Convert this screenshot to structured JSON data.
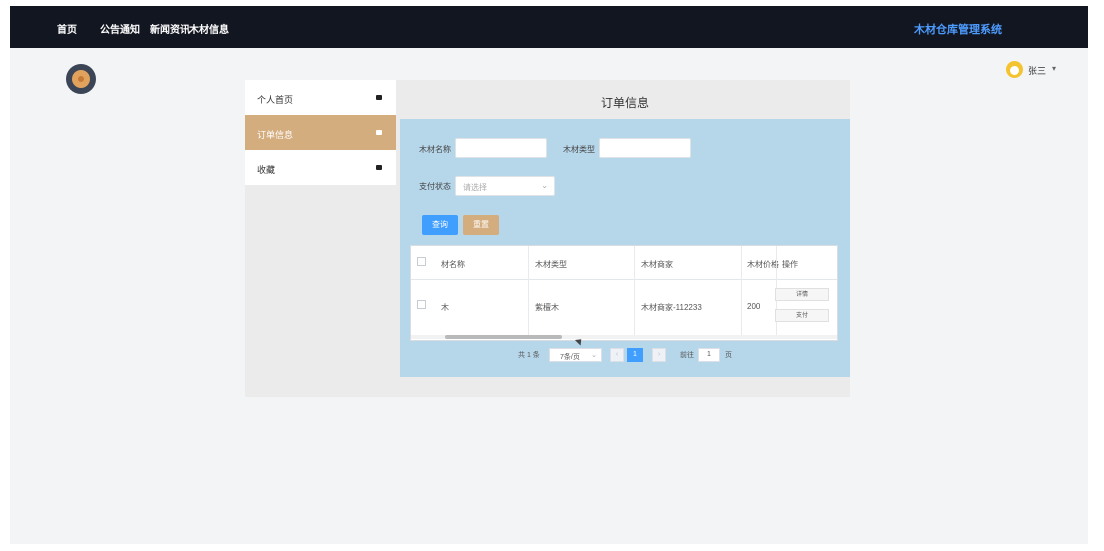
{
  "navbar": {
    "items": [
      "首页",
      "公告通知",
      "新闻资讯",
      "木材信息"
    ],
    "brand": "木材仓库管理系统",
    "user_name": "张三"
  },
  "sidebar": {
    "items": [
      {
        "label": "个人首页"
      },
      {
        "label": "订单信息"
      },
      {
        "label": "收藏"
      }
    ]
  },
  "content": {
    "title": "订单信息",
    "filters": {
      "name_label": "木材名称",
      "type_label": "木材类型",
      "status_label": "支付状态",
      "status_placeholder": "请选择"
    },
    "buttons": {
      "query": "查询",
      "reset": "重置"
    },
    "table": {
      "headers": [
        "材名称",
        "木材类型",
        "木材商家",
        "木材价格",
        "操作"
      ],
      "rows": [
        {
          "name": "木",
          "type": "紫檀木",
          "merchant": "木材商家-112233",
          "price": "200",
          "actions": [
            "详情",
            "支付"
          ]
        }
      ]
    },
    "pagination": {
      "total": "共 1 条",
      "page_size": "7条/页",
      "current": "1",
      "goto_label": "前往",
      "goto_value": "1",
      "page_suffix": "页"
    }
  },
  "colors": {
    "navbar_bg": "#121621",
    "brand": "#4d9cff",
    "active_menu": "#d4ad7f",
    "content_bg": "#b6d6ea",
    "query_button": "#409eff",
    "reset_button": "#d4ad7f"
  }
}
